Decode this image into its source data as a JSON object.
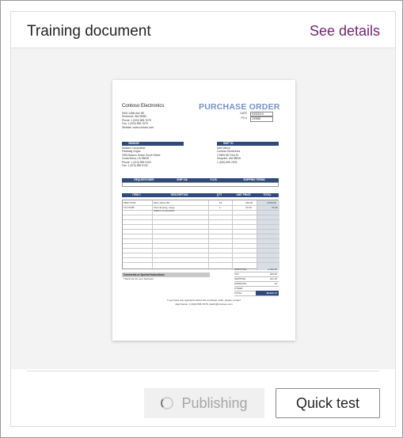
{
  "header": {
    "title": "Training document",
    "link": "See details"
  },
  "footer": {
    "publishing_label": "Publishing",
    "quick_test_label": "Quick test"
  },
  "colors": {
    "accent": "#742774",
    "po_title": "#7591c8",
    "table_header": "#2e4a7d"
  },
  "icons": {
    "spinner": "spinner-icon"
  },
  "document": {
    "company": "Contoso Electronics",
    "title": "PURCHASE ORDER",
    "address_lines": [
      "5000 148th Ave NE",
      "Redmond, WA 98052",
      "Phone: 1 (000) 555-7678",
      "Fax: 1 (000) 555-7679",
      "Website: www.contoso.com"
    ],
    "meta": [
      {
        "label": "DATE",
        "value": "5/29/2019"
      },
      {
        "label": "PO #",
        "value": "100988"
      }
    ],
    "vendor": {
      "header": "VENDOR",
      "lines": [
        "Adatum Corporation",
        "Paddraig Cuglia",
        "3333 Branno Simon South Street",
        "Costa Mesa, CA 95628",
        "Phone: 1 (313) 555-9163",
        "Fax: 1 (313) 555-9133"
      ]
    },
    "ship_to": {
      "header": "SHIP TO",
      "lines": [
        "Adel Vance",
        "Contoso Electronics",
        "2 6500 NE 91st St",
        "Seapoint, WA 98026",
        "1 (000) 555-7678"
      ]
    },
    "shipping_headers": [
      "REQUISITIONER",
      "SHIP VIA",
      "F.O.B.",
      "SHIPPING TERMS"
    ],
    "item_headers": [
      "ITEM #",
      "DESCRIPTION",
      "QTY",
      "UNIT PRICE",
      "TOTAL"
    ],
    "items": [
      {
        "item": "0892-TSSS",
        "desc": "Micro Motor 80",
        "qty": "15",
        "unit": "160.00",
        "total": "2,250.00"
      },
      {
        "item": "TH-TS786",
        "desc": "Test Housing, Large",
        "qty": "1",
        "unit": "70.00",
        "total": "70.00"
      },
      {
        "item": "",
        "desc": "Adatum Corporation",
        "qty": "",
        "unit": "",
        "total": ""
      }
    ],
    "comments": {
      "header": "Comments or Special Instructions",
      "text": "Thank you for your business."
    },
    "totals": [
      {
        "label": "SUBTOTAL",
        "value": "2,320.00"
      },
      {
        "label": "TAX",
        "value": "206.00"
      },
      {
        "label": "SHIPPING",
        "value": "101.20"
      },
      {
        "label": "HANDLING",
        "value": "24"
      },
      {
        "label": "OTHER",
        "value": ""
      },
      {
        "label": "TOTAL",
        "value": "$2,617.17"
      }
    ],
    "footer_lines": [
      "If you have any questions about this purchase order, please contact",
      "Adel Vance, 1 (000) 555-7678, AdelV@Contoso.com"
    ]
  }
}
